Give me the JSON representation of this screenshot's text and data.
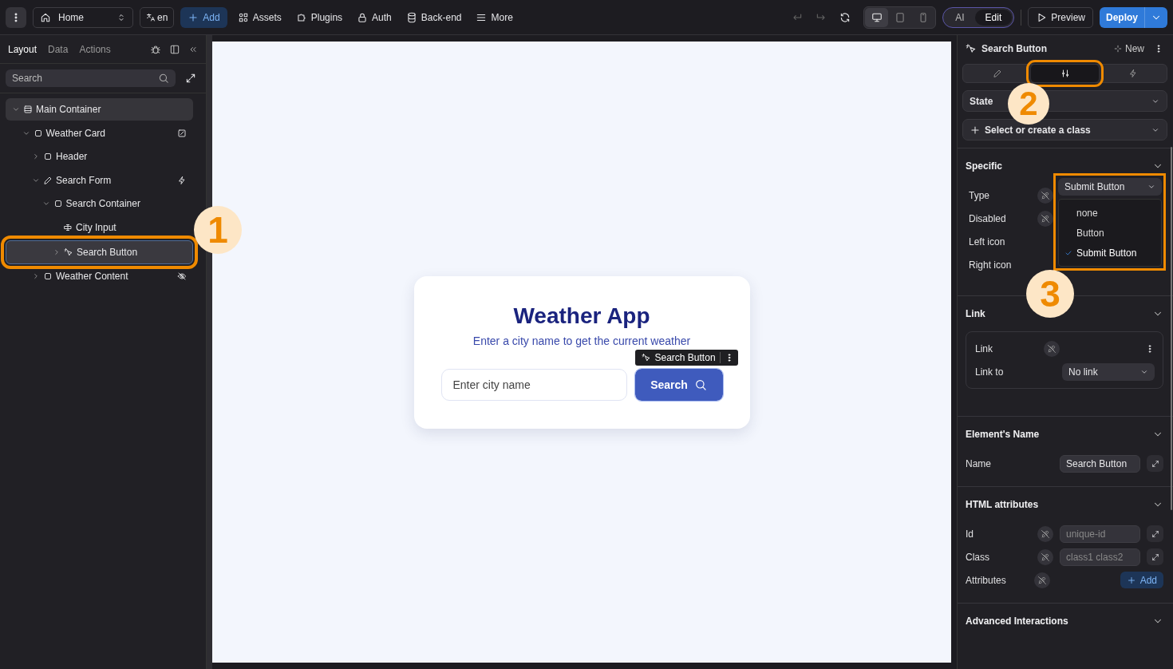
{
  "topbar": {
    "page": "Home",
    "language": "en",
    "add": "Add",
    "nav": [
      {
        "kind": "shapes",
        "label": "Assets"
      },
      {
        "kind": "puzzle",
        "label": "Plugins"
      },
      {
        "kind": "lock",
        "label": "Auth"
      },
      {
        "kind": "database",
        "label": "Back-end"
      },
      {
        "kind": "menu",
        "label": "More"
      }
    ],
    "devices": [
      {
        "kind": "desktop",
        "selected": true
      },
      {
        "kind": "tablet",
        "selected": false
      },
      {
        "kind": "phone",
        "selected": false
      }
    ],
    "modes": [
      {
        "label": "AI",
        "selected": false
      },
      {
        "label": "Edit",
        "selected": true
      }
    ],
    "preview": "Preview",
    "deploy": "Deploy"
  },
  "left_panel": {
    "tabs": [
      {
        "label": "Layout",
        "selected": true
      },
      {
        "label": "Data",
        "selected": false
      },
      {
        "label": "Actions",
        "selected": false
      }
    ],
    "search": {
      "placeholder": "Search"
    },
    "tree": [
      {
        "label": "Main Container",
        "kind": "container",
        "expanded": true,
        "selected": false,
        "hovered": true,
        "hidden": false,
        "has_workflow": false,
        "has_binding": false,
        "children": [
          {
            "label": "Weather Card",
            "kind": "box",
            "expanded": true,
            "selected": false,
            "hovered": false,
            "hidden": false,
            "has_workflow": false,
            "has_binding": true,
            "children": [
              {
                "label": "Header",
                "kind": "box",
                "expanded": false,
                "selected": false,
                "hovered": false,
                "hidden": false,
                "has_workflow": false,
                "has_binding": false
              },
              {
                "label": "Search Form",
                "kind": "form",
                "expanded": true,
                "selected": false,
                "hovered": false,
                "hidden": false,
                "has_workflow": true,
                "has_binding": false,
                "children": [
                  {
                    "label": "Search Container",
                    "kind": "box",
                    "expanded": true,
                    "selected": false,
                    "hovered": false,
                    "hidden": false,
                    "has_workflow": false,
                    "has_binding": false,
                    "children": [
                      {
                        "label": "City Input",
                        "kind": "input",
                        "selected": false,
                        "hovered": false,
                        "hidden": false,
                        "has_workflow": false,
                        "has_binding": false
                      },
                      {
                        "label": "Search Button",
                        "kind": "button",
                        "expanded": false,
                        "selected": true,
                        "hovered": false,
                        "hidden": false,
                        "has_workflow": false,
                        "has_binding": false
                      }
                    ]
                  }
                ]
              },
              {
                "label": "Weather Content",
                "kind": "box",
                "expanded": false,
                "selected": false,
                "hovered": false,
                "hidden": true,
                "has_workflow": false,
                "has_binding": false
              }
            ]
          }
        ]
      }
    ]
  },
  "canvas": {
    "title": "Weather App",
    "subtitle": "Enter a city name to get the current weather",
    "input": {
      "placeholder": "Enter city name"
    },
    "button": "Search",
    "selection_label": "Search Button"
  },
  "right_panel": {
    "title": "Search Button",
    "new": "New",
    "tabs": [
      {
        "kind": "pencil",
        "selected": false
      },
      {
        "kind": "sliders",
        "selected": true
      },
      {
        "kind": "bolt",
        "selected": false
      }
    ],
    "state": "State",
    "class_select": "Select or create a class",
    "specific": {
      "title": "Specific",
      "type_value": "Submit Button",
      "rows": [
        {
          "label": "Type",
          "bindable": true
        },
        {
          "label": "Disabled",
          "bindable": true
        },
        {
          "label": "Left icon",
          "bindable": false
        },
        {
          "label": "Right icon",
          "bindable": false
        }
      ],
      "type_options": [
        {
          "label": "none",
          "selected": false
        },
        {
          "label": "Button",
          "selected": false
        },
        {
          "label": "Submit Button",
          "selected": true
        }
      ]
    },
    "link": {
      "title": "Link",
      "link_label": "Link",
      "link_to_label": "Link to",
      "link_to": "No link"
    },
    "element_name": {
      "title": "Element's Name",
      "label": "Name",
      "value": "Search Button"
    },
    "html_attributes": {
      "title": "HTML attributes",
      "id_label": "Id",
      "id_placeholder": "unique-id",
      "class_label": "Class",
      "class_placeholder": "class1 class2",
      "attributes_label": "Attributes",
      "add": "Add"
    },
    "advanced": {
      "title": "Advanced Interactions"
    }
  },
  "annotations": [
    {
      "label": "1"
    },
    {
      "label": "2"
    },
    {
      "label": "3"
    }
  ]
}
